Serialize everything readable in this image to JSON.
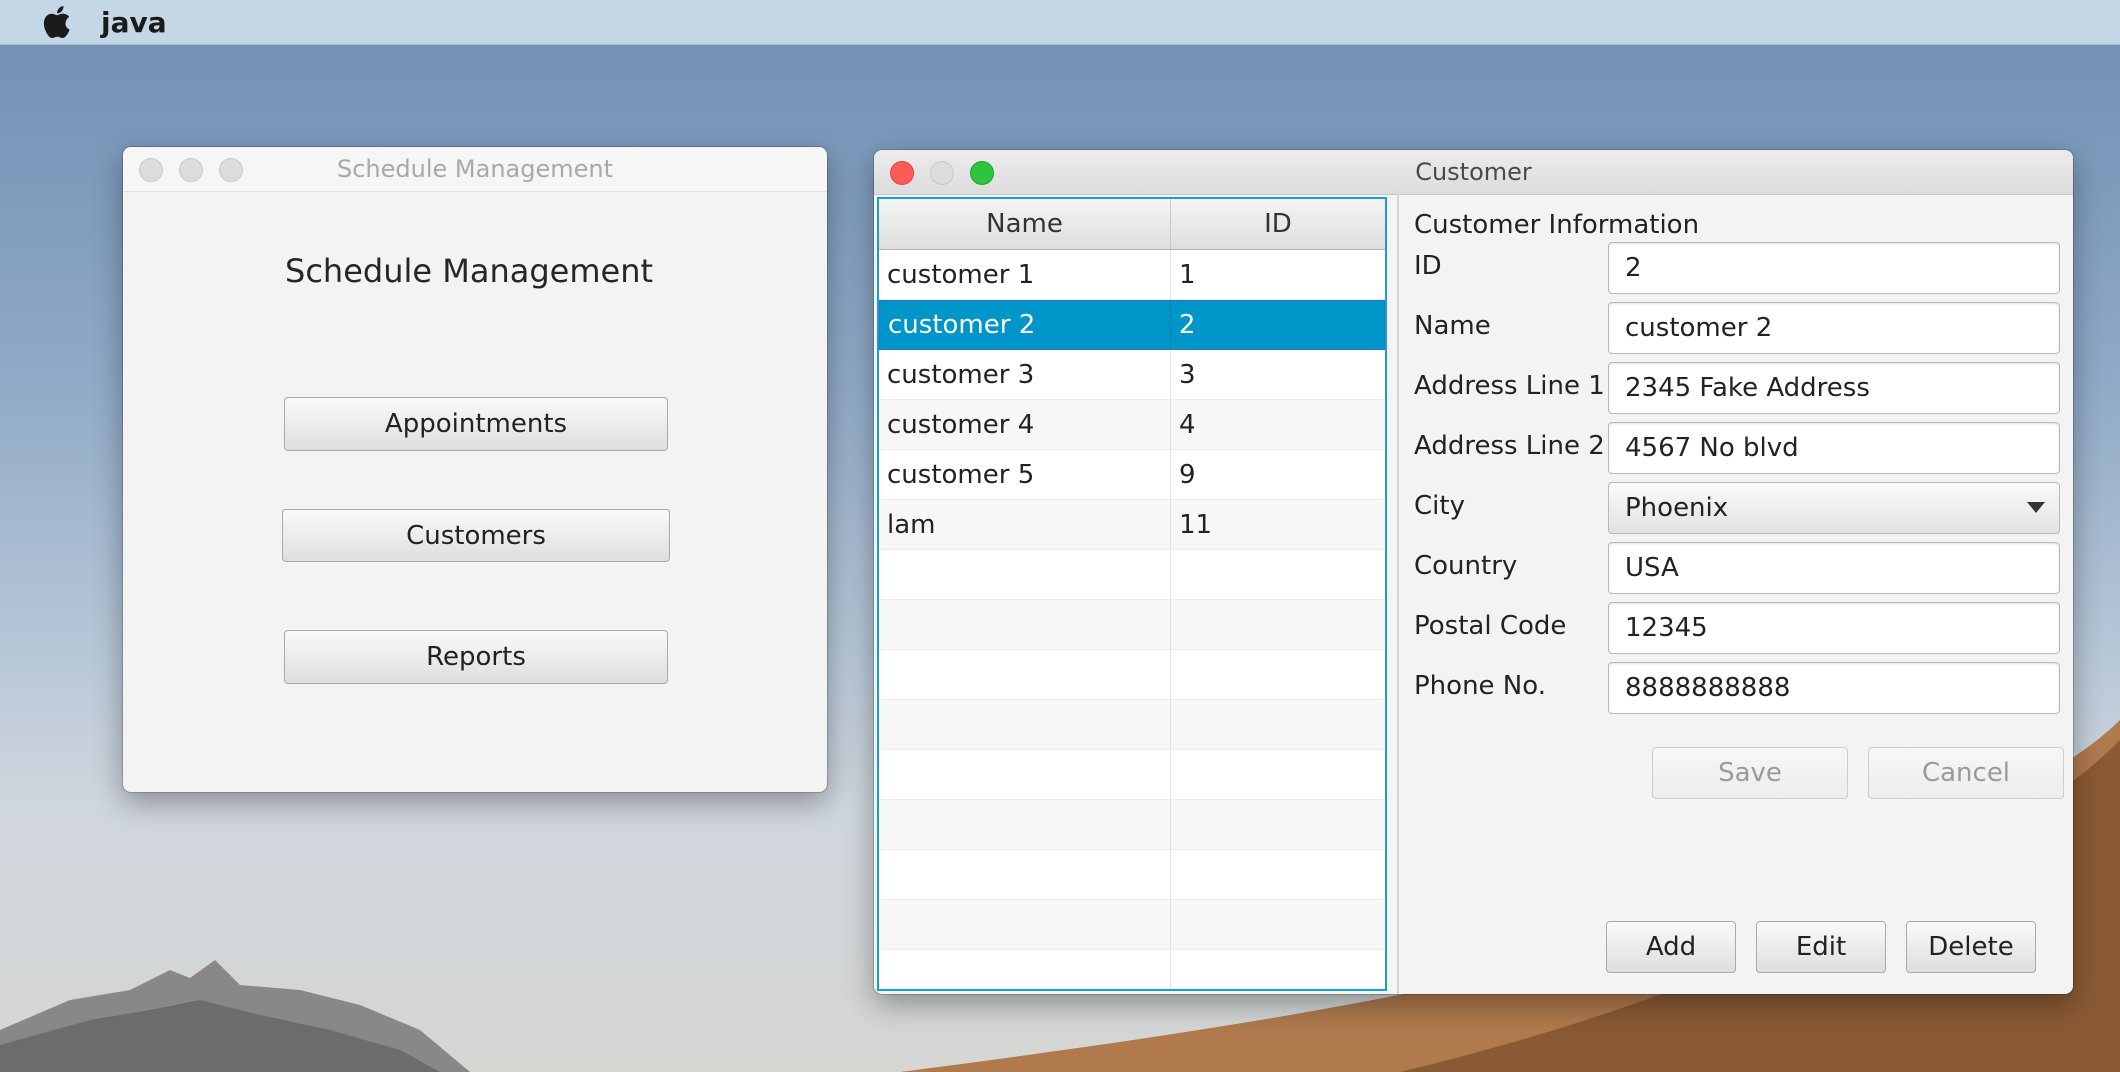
{
  "menubar": {
    "app_name": "java"
  },
  "schedule_window": {
    "title": "Schedule Management",
    "heading": "Schedule Management",
    "buttons": [
      "Appointments",
      "Customers",
      "Reports"
    ]
  },
  "customer_window": {
    "title": "Customer",
    "table": {
      "columns": [
        "Name",
        "ID"
      ],
      "rows": [
        {
          "name": "customer 1",
          "id": "1"
        },
        {
          "name": "customer 2",
          "id": "2"
        },
        {
          "name": "customer 3",
          "id": "3"
        },
        {
          "name": "customer 4",
          "id": "4"
        },
        {
          "name": "customer 5",
          "id": "9"
        },
        {
          "name": "lam",
          "id": "11"
        }
      ],
      "selected_index": 1
    },
    "form": {
      "section_title": "Customer Information",
      "fields": [
        {
          "label": "ID",
          "value": "2"
        },
        {
          "label": "Name",
          "value": "customer 2"
        },
        {
          "label": "Address Line 1",
          "value": "2345 Fake Address"
        },
        {
          "label": "Address Line 2",
          "value": "4567 No blvd"
        },
        {
          "label": "City",
          "value": "Phoenix"
        },
        {
          "label": "Country",
          "value": "USA"
        },
        {
          "label": "Postal Code",
          "value": "12345"
        },
        {
          "label": "Phone No.",
          "value": "8888888888"
        }
      ],
      "save_label": "Save",
      "cancel_label": "Cancel",
      "add_label": "Add",
      "edit_label": "Edit",
      "delete_label": "Delete"
    }
  }
}
